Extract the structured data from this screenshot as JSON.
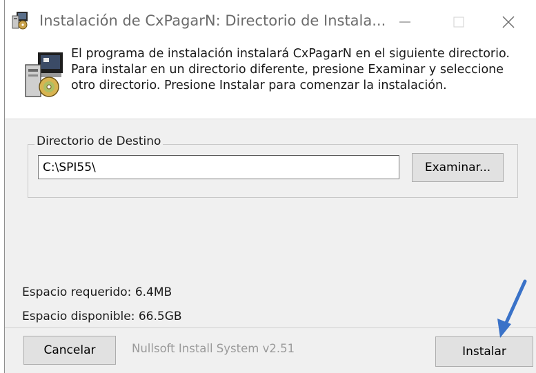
{
  "window": {
    "title": "Instalación de CxPagarN: Directorio de Instala..."
  },
  "header": {
    "description": "El programa de instalación instalará CxPagarN en el siguiente directorio. Para instalar en un directorio diferente, presione Examinar y seleccione otro directorio. Presione Instalar para comenzar la instalación."
  },
  "destination": {
    "group_label": "Directorio de Destino",
    "path_value": "C:\\SPI55\\",
    "browse_label": "Examinar..."
  },
  "space": {
    "required": "Espacio requerido: 6.4MB",
    "available": "Espacio disponible: 66.5GB"
  },
  "footer": {
    "cancel_label": "Cancelar",
    "brand": "Nullsoft Install System v2.51",
    "install_label": "Instalar"
  },
  "icons": {
    "title": "installer-icon",
    "header": "install-package-icon",
    "annotation": "blue-arrow"
  },
  "colors": {
    "arrow": "#3a72c8"
  }
}
